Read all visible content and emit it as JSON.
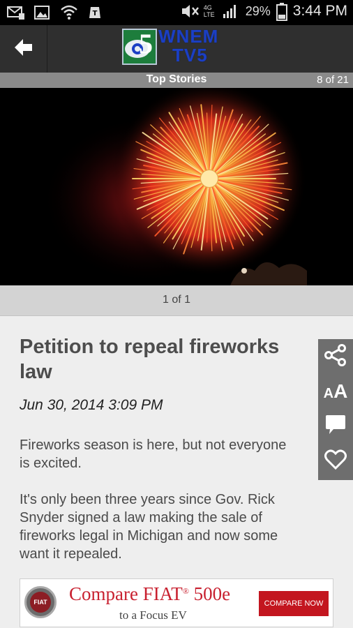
{
  "status_bar": {
    "battery_percent": "29%",
    "time": "3:44 PM",
    "network_label": "4G LTE",
    "icons": [
      "mail-icon",
      "image-icon",
      "wifi-icon",
      "tmobile-icon",
      "mute-icon",
      "signal-icon",
      "battery-icon"
    ]
  },
  "app_bar": {
    "back_icon": "back-arrow-icon",
    "logo_line1": "WNEM",
    "logo_line2": "TV5",
    "logo_badge": "5"
  },
  "section": {
    "title": "Top Stories",
    "position": "8 of 21"
  },
  "gallery": {
    "counter": "1 of 1"
  },
  "article": {
    "headline": "Petition to repeal fireworks law",
    "date": "Jun 30, 2014 3:09 PM",
    "paragraphs": [
      "Fireworks season is here, but not everyone is excited.",
      "It's only been three years since Gov. Rick Snyder signed a law making the sale of fireworks legal in Michigan and now some want it repealed."
    ]
  },
  "actions": {
    "text_size_small": "A",
    "text_size_large": "A",
    "icons": [
      "share-icon",
      "text-size-icon",
      "comment-icon",
      "favorite-heart-icon"
    ]
  },
  "ad": {
    "brand": "FIAT",
    "headline": "Compare FIAT",
    "registered_mark": "®",
    "model": "500e",
    "subline": "to a Focus EV",
    "cta": "COMPARE NOW"
  },
  "colors": {
    "app_bar": "#2f2f2f",
    "section_bar": "#8a8a8a",
    "article_bg": "#eeeeee",
    "ad_red": "#c3161f"
  }
}
